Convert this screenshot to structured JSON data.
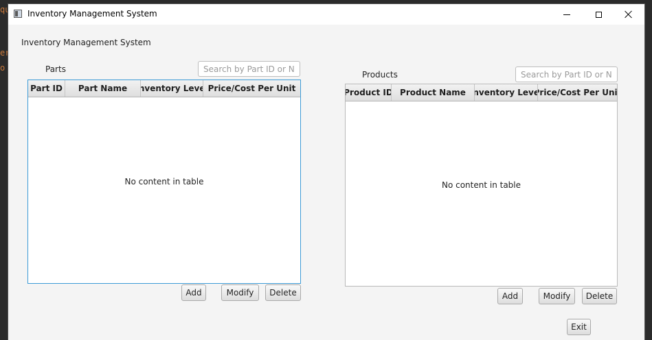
{
  "window": {
    "title": "Inventory Management System"
  },
  "background_text": [
    "qu",
    "er",
    "o"
  ],
  "main": {
    "heading": "Inventory Management System"
  },
  "parts": {
    "label": "Parts",
    "search_placeholder": "Search by Part ID or Name",
    "columns": [
      "Part ID",
      "Part Name",
      "Inventory Level",
      "Price/Cost Per Unit"
    ],
    "empty_text": "No content in table",
    "buttons": {
      "add": "Add",
      "modify": "Modify",
      "delete": "Delete"
    }
  },
  "products": {
    "label": "Products",
    "search_placeholder": "Search by Part ID or Name",
    "columns": [
      "Product ID",
      "Product Name",
      "Inventory Level",
      "Price/Cost Per Unit"
    ],
    "empty_text": "No content in table",
    "buttons": {
      "add": "Add",
      "modify": "Modify",
      "delete": "Delete"
    }
  },
  "exit_label": "Exit",
  "colors": {
    "focus_border": "#3c9ad6",
    "window_bg": "#f4f4f4",
    "desktop_bg": "#2b2b2b"
  }
}
